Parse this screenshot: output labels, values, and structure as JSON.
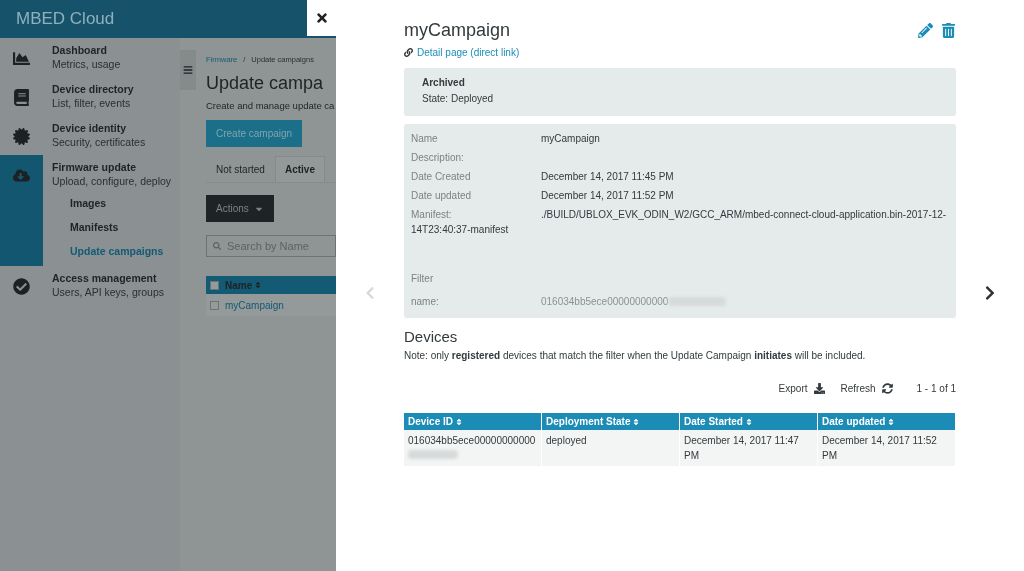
{
  "app": {
    "logo": "MBED Cloud"
  },
  "sidebar": {
    "items": [
      {
        "title": "Dashboard",
        "subtitle": "Metrics, usage",
        "selected": false
      },
      {
        "title": "Device directory",
        "subtitle": "List, filter, events",
        "selected": false
      },
      {
        "title": "Device identity",
        "subtitle": "Security, certificates",
        "selected": false
      },
      {
        "title": "Firmware update",
        "subtitle": "Upload, configure, deploy",
        "selected": true,
        "children": [
          {
            "label": "Images",
            "selected": false
          },
          {
            "label": "Manifests",
            "selected": false
          },
          {
            "label": "Update campaigns",
            "selected": true
          }
        ]
      },
      {
        "title": "Access management",
        "subtitle": "Users, API keys, groups",
        "selected": false
      }
    ]
  },
  "page": {
    "breadcrumbs": [
      "Firmware",
      "Update campaigns"
    ],
    "breadcrumb_separator": "/",
    "title": "Update campa",
    "subtitle": "Create and manage update ca",
    "create_button": "Create campaign",
    "tabs": [
      {
        "label": "Not started",
        "selected": false
      },
      {
        "label": "Active",
        "selected": true
      }
    ],
    "actions_button": "Actions",
    "search": {
      "placeholder": "Search by Name"
    },
    "table": {
      "select_all_checked": false,
      "columns": [
        "Name"
      ],
      "rows": [
        {
          "name": "myCampaign",
          "checked": false
        }
      ]
    }
  },
  "detail": {
    "title": "myCampaign",
    "link": "Detail page (direct link)",
    "status": {
      "title": "Archived",
      "state": "State: Deployed"
    },
    "fields": [
      {
        "kind": "row",
        "label": "Name",
        "value": "myCampaign"
      },
      {
        "kind": "row",
        "label": "Description:"
      },
      {
        "kind": "row",
        "label": "Date Created",
        "value": "December 14, 2017 11:45 PM"
      },
      {
        "kind": "row",
        "label": "Date updated",
        "value": "December 14, 2017 11:52 PM"
      },
      {
        "kind": "wrap",
        "label": "Manifest:",
        "value": "./BUILD/UBLOX_EVK_ODIN_W2/GCC_ARM/mbed-connect-cloud-application.bin-2017-12-14T23:40:37-manifest"
      }
    ],
    "filter": {
      "title": "Filter",
      "label": "name:",
      "value": "016034bb5ece00000000000"
    },
    "devices": {
      "title": "Devices",
      "note": "Note: only **registered** devices that match the filter when the Update Campaign **initiates** will be included.",
      "export": "Export",
      "refresh": "Refresh",
      "pager": "1 - 1 of 1",
      "columns": [
        "Device ID",
        "Deployment State",
        "Date Started",
        "Date updated"
      ],
      "rows": [
        [
          "016034bb5ece00000000000",
          "deployed",
          "December 14, 2017 11:47 PM",
          "December 14, 2017 11:52 PM"
        ]
      ]
    }
  }
}
